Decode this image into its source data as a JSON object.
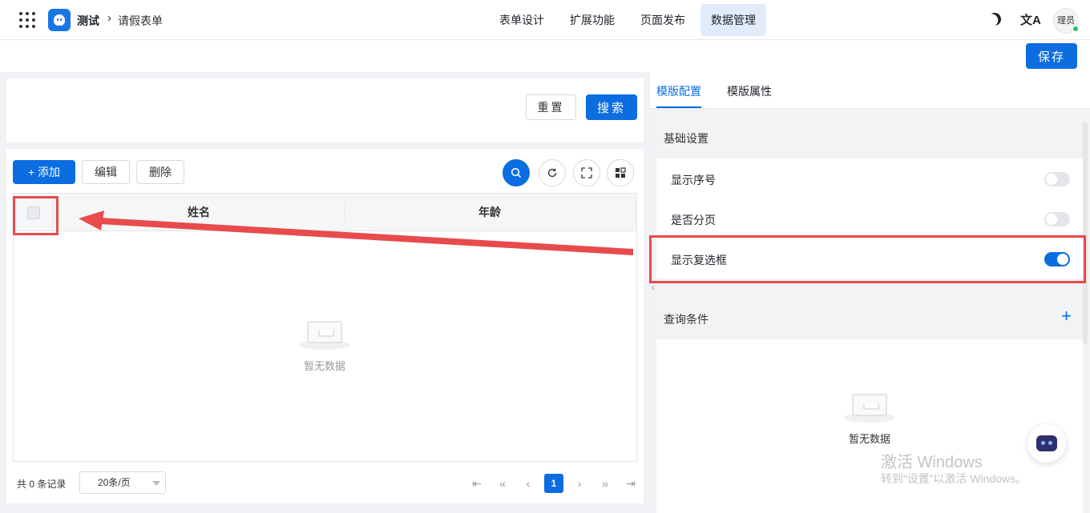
{
  "header": {
    "app_name": "测试",
    "breadcrumb_sep": "›",
    "page_name": "请假表单",
    "tabs": [
      {
        "label": "表单设计"
      },
      {
        "label": "扩展功能"
      },
      {
        "label": "页面发布"
      },
      {
        "label": "数据管理",
        "active": true
      }
    ],
    "lang_icon_glyph": "文A",
    "avatar_text": "理员"
  },
  "savebar": {
    "save_label": "保存"
  },
  "search": {
    "reset_label": "重置",
    "search_label": "搜索"
  },
  "toolbar": {
    "add_label": "+ 添加",
    "edit_label": "编辑",
    "delete_label": "删除",
    "icons": [
      "search-icon",
      "refresh-icon",
      "fullscreen-icon",
      "layout-icon"
    ]
  },
  "table": {
    "columns": [
      "姓名",
      "年龄"
    ],
    "rows": [],
    "empty_text": "暂无数据"
  },
  "pagination": {
    "total_text": "共 0 条记录",
    "page_size": "20条/页",
    "current_page": "1",
    "first": "⇤",
    "prev_fast": "«",
    "prev": "‹",
    "next": "›",
    "next_fast": "»",
    "last": "⇥"
  },
  "right_panel": {
    "tabs": [
      {
        "label": "模版配置",
        "active": true
      },
      {
        "label": "模版属性"
      }
    ],
    "basic_section": "基础设置",
    "settings": [
      {
        "label": "显示序号",
        "on": false
      },
      {
        "label": "是否分页",
        "on": false
      },
      {
        "label": "显示复选框",
        "on": true
      }
    ],
    "query_section": "查询条件",
    "query_add": "+",
    "query_empty_text": "暂无数据"
  },
  "watermark": {
    "line1": "激活 Windows",
    "line2": "转到“设置”以激活 Windows。"
  },
  "colors": {
    "primary": "#0b6de0",
    "annotation_red": "#e84b4b",
    "active_tab_bg": "#e1ecfb"
  }
}
